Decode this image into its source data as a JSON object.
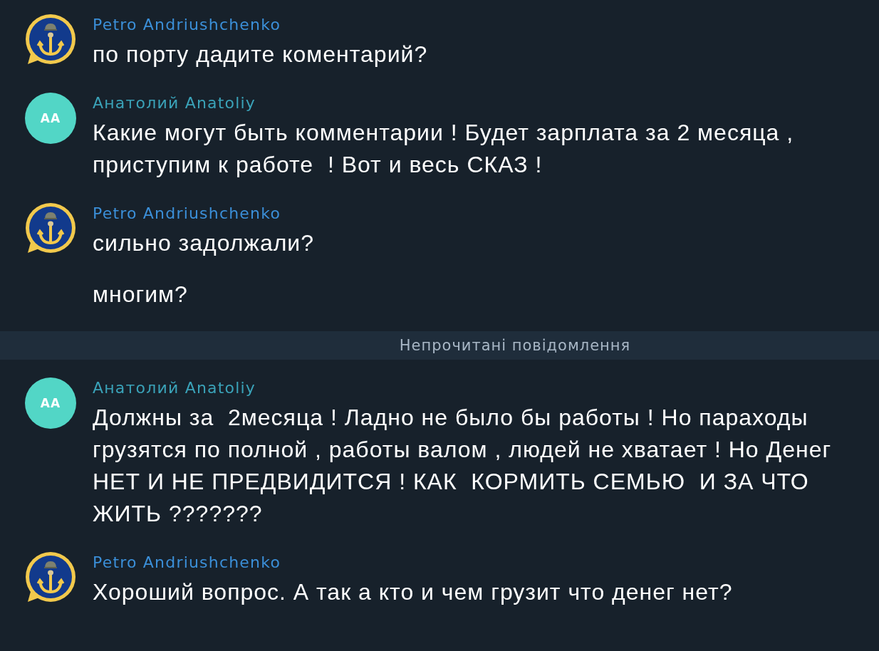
{
  "messages": [
    {
      "kind": "group",
      "sender": "Petro Andriushchenko",
      "color": "#3b8fd8",
      "avatar": {
        "kind": "logo"
      },
      "texts": [
        "по порту дадите коментарий?"
      ]
    },
    {
      "kind": "group",
      "sender": "Анатолий Anatoliy",
      "color": "#3aa2b8",
      "avatar": {
        "kind": "initials",
        "initials": "AA",
        "color": "#52d6c6"
      },
      "texts": [
        "Какие могут быть комментарии ! Будет зарплата за 2 месяца , приступим к работе  ! Вот и весь СКАЗ !"
      ]
    },
    {
      "kind": "group",
      "sender": "Petro Andriushchenko",
      "color": "#3b8fd8",
      "avatar": {
        "kind": "logo"
      },
      "texts": [
        "сильно задолжали?",
        "многим?"
      ]
    },
    {
      "kind": "divider",
      "label": "Непрочитані повідомлення"
    },
    {
      "kind": "group",
      "sender": "Анатолий Anatoliy",
      "color": "#3aa2b8",
      "avatar": {
        "kind": "initials",
        "initials": "AA",
        "color": "#52d6c6"
      },
      "texts": [
        "Должны за  2месяца ! Ладно не было бы работы ! Но параходы грузятся по полной , работы валом , людей не хватает ! Но Денег НЕТ И НЕ ПРЕДВИДИТСЯ ! КАК  КОРМИТЬ СЕМЬЮ  И ЗА ЧТО ЖИТЬ ???????"
      ]
    },
    {
      "kind": "group",
      "sender": "Petro Andriushchenko",
      "color": "#3b8fd8",
      "avatar": {
        "kind": "logo"
      },
      "texts": [
        "Хороший вопрос. А так а кто и чем грузит что денег нет?"
      ]
    }
  ]
}
